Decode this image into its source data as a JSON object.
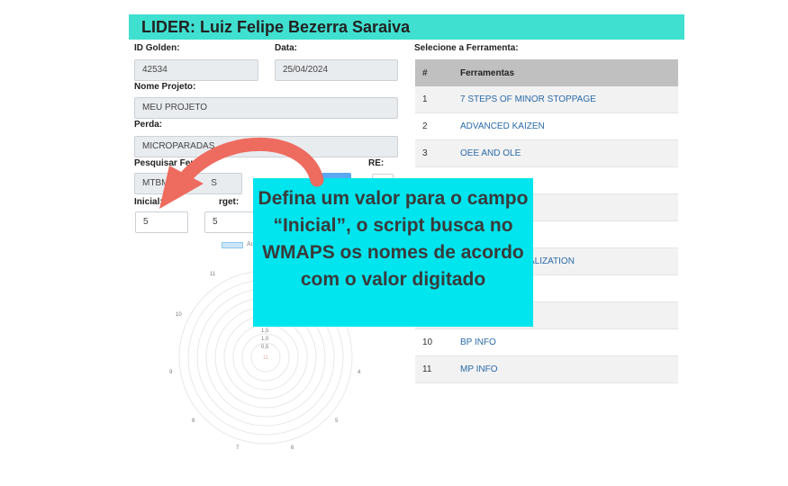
{
  "header": {
    "title": "LIDER: Luiz Felipe Bezerra Saraiva"
  },
  "form": {
    "id_golden_label": "ID Golden:",
    "id_golden_value": "42534",
    "date_label": "Data:",
    "date_value": "25/04/2024",
    "project_label": "Nome Projeto:",
    "project_value": "MEU PROJETO",
    "loss_label": "Perda:",
    "loss_value": "MICROPARADAS",
    "search_label": "Pesquisar Ferram",
    "search_value_a": "MTBM",
    "search_value_b": "S",
    "re_label": "RE:",
    "initial_label": "Inicial:",
    "initial_value": "5",
    "target_label": "rget:",
    "target_value": "5"
  },
  "tools": {
    "title": "Selecione a Ferramenta:",
    "columns": [
      "#",
      "Ferramentas"
    ],
    "rows": [
      {
        "num": "1",
        "name": "7 STEPS OF MINOR STOPPAGE"
      },
      {
        "num": "2",
        "name": "ADVANCED KAIZEN"
      },
      {
        "num": "3",
        "name": "OEE AND OLE"
      },
      {
        "num": "",
        "name": ""
      },
      {
        "num": "",
        "name": ""
      },
      {
        "num": "",
        "name": ""
      },
      {
        "num": "",
        "name": "ALIZATION"
      },
      {
        "num": "",
        "name": ""
      },
      {
        "num": "",
        "name": ""
      },
      {
        "num": "10",
        "name": "BP INFO"
      },
      {
        "num": "11",
        "name": "MP INFO"
      }
    ]
  },
  "chart": {
    "legend_label": "Au",
    "axis_labels": [
      "11",
      "10",
      "9",
      "8",
      "7",
      "6",
      "5",
      "4"
    ],
    "tick_labels": [
      "1,5",
      "1,0",
      "0,5"
    ],
    "center_label": "11"
  },
  "callout": {
    "text": "Defina um valor para o campo “Inicial”, o script busca no WMAPS os nomes de acordo com o valor digitado"
  },
  "colors": {
    "header": "#40e0d0",
    "callout": "#00e5ee",
    "arrow": "#ee6b5f"
  }
}
